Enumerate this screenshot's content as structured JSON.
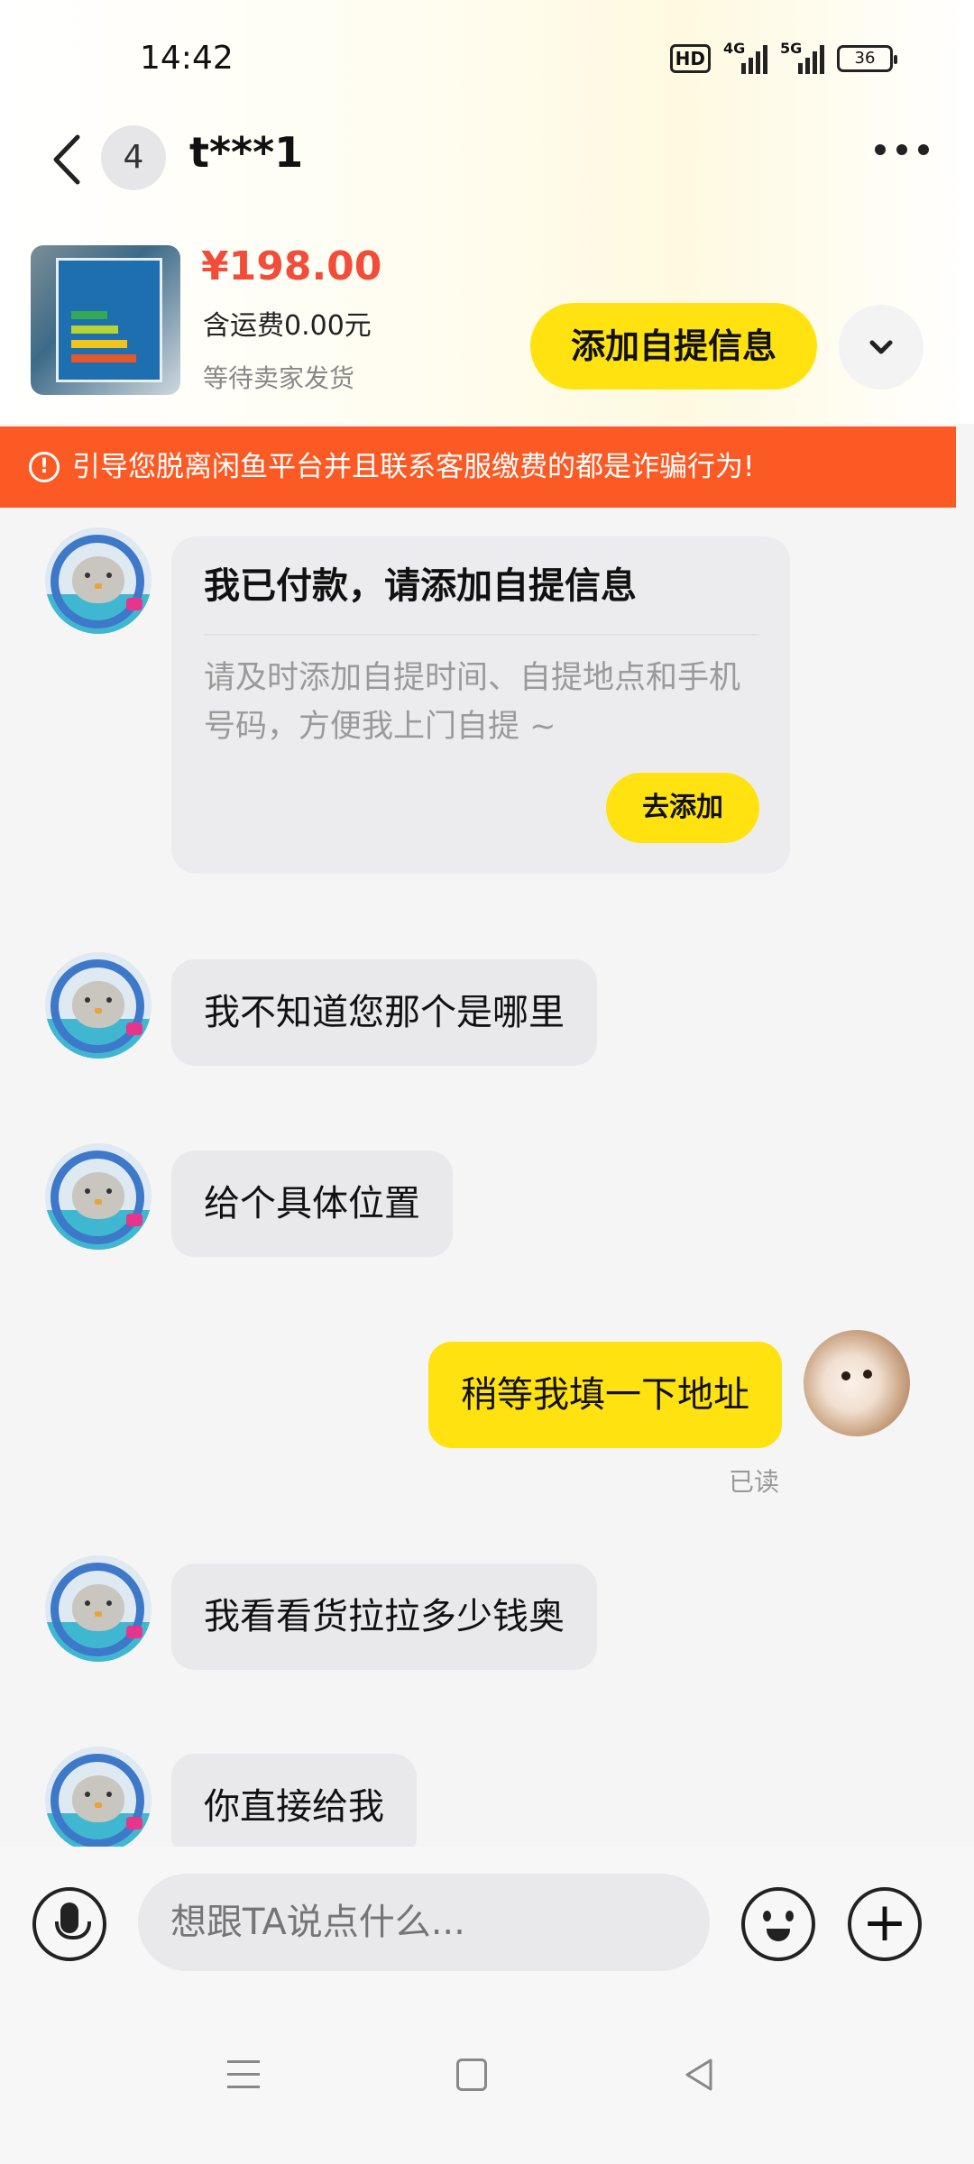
{
  "status_bar": {
    "time": "14:42",
    "hd_label": "HD",
    "net_1": "4G",
    "net_2": "5G",
    "battery": "36"
  },
  "header": {
    "unread_count": "4",
    "title": "t***1"
  },
  "product": {
    "price": "¥198.00",
    "shipping": "含运费0.00元",
    "status": "等待卖家发货",
    "action_label": "添加自提信息"
  },
  "warning": {
    "text": "引导您脱离闲鱼平台并且联系客服缴费的都是诈骗行为!"
  },
  "chat": {
    "card": {
      "title": "我已付款，请添加自提信息",
      "body": "请及时添加自提时间、自提地点和手机号码，方便我上门自提 ~",
      "button_label": "去添加"
    },
    "messages": [
      {
        "from": "other",
        "text": "我不知道您那个是哪里"
      },
      {
        "from": "other",
        "text": "给个具体位置"
      },
      {
        "from": "me",
        "text": "稍等我填一下地址"
      },
      {
        "from": "other",
        "text": "我看看货拉拉多少钱奥"
      },
      {
        "from": "other",
        "text": "你直接给我"
      }
    ],
    "read_receipt": "已读"
  },
  "input_bar": {
    "placeholder": "想跟TA说点什么..."
  },
  "colors": {
    "accent_yellow": "#ffe20f",
    "price_red": "#f24d3a",
    "warning_orange": "#fb5a24"
  },
  "icons": {
    "back": "chevron-left-icon",
    "more": "more-dots-icon",
    "expand": "chevron-down-icon",
    "warning": "alert-circle-icon",
    "voice": "microphone-icon",
    "emoji": "smiley-icon",
    "add": "plus-circle-icon"
  }
}
